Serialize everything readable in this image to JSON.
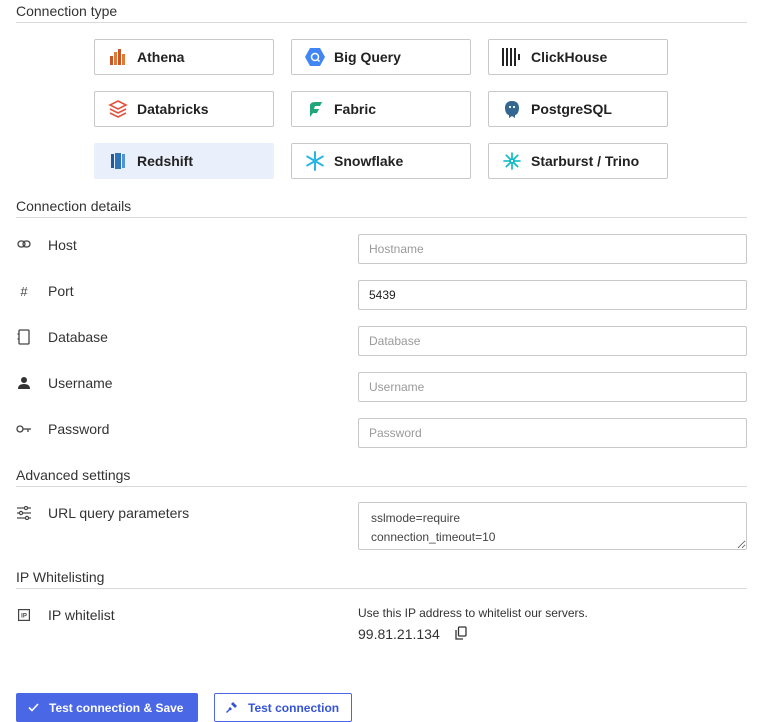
{
  "sections": {
    "connection_type": "Connection type",
    "connection_details": "Connection details",
    "advanced_settings": "Advanced settings",
    "ip_whitelisting": "IP Whitelisting"
  },
  "connection_types": [
    {
      "label": "Athena",
      "icon": "athena-icon",
      "selected": false
    },
    {
      "label": "Big Query",
      "icon": "bigquery-icon",
      "selected": false
    },
    {
      "label": "ClickHouse",
      "icon": "clickhouse-icon",
      "selected": false
    },
    {
      "label": "Databricks",
      "icon": "databricks-icon",
      "selected": false
    },
    {
      "label": "Fabric",
      "icon": "fabric-icon",
      "selected": false
    },
    {
      "label": "PostgreSQL",
      "icon": "postgresql-icon",
      "selected": false
    },
    {
      "label": "Redshift",
      "icon": "redshift-icon",
      "selected": true
    },
    {
      "label": "Snowflake",
      "icon": "snowflake-icon",
      "selected": false
    },
    {
      "label": "Starburst / Trino",
      "icon": "starburst-icon",
      "selected": false
    }
  ],
  "fields": {
    "host": {
      "label": "Host",
      "value": "",
      "placeholder": "Hostname",
      "icon": "link-icon"
    },
    "port": {
      "label": "Port",
      "value": "5439",
      "placeholder": "",
      "icon": "hash-icon"
    },
    "database": {
      "label": "Database",
      "value": "",
      "placeholder": "Database",
      "icon": "database-icon"
    },
    "username": {
      "label": "Username",
      "value": "",
      "placeholder": "Username",
      "icon": "user-icon"
    },
    "password": {
      "label": "Password",
      "value": "",
      "placeholder": "Password",
      "icon": "key-icon"
    }
  },
  "advanced": {
    "url_params_label": "URL query parameters",
    "url_params_value": "sslmode=require\nconnection_timeout=10",
    "icon": "sliders-icon"
  },
  "ip": {
    "label": "IP whitelist",
    "note": "Use this IP address to whitelist our servers.",
    "address": "99.81.21.134",
    "icon": "ip-icon"
  },
  "buttons": {
    "save": "Test connection & Save",
    "test": "Test connection"
  },
  "colors": {
    "accent": "#4a67e6",
    "selected_tile": "#e9effb"
  }
}
